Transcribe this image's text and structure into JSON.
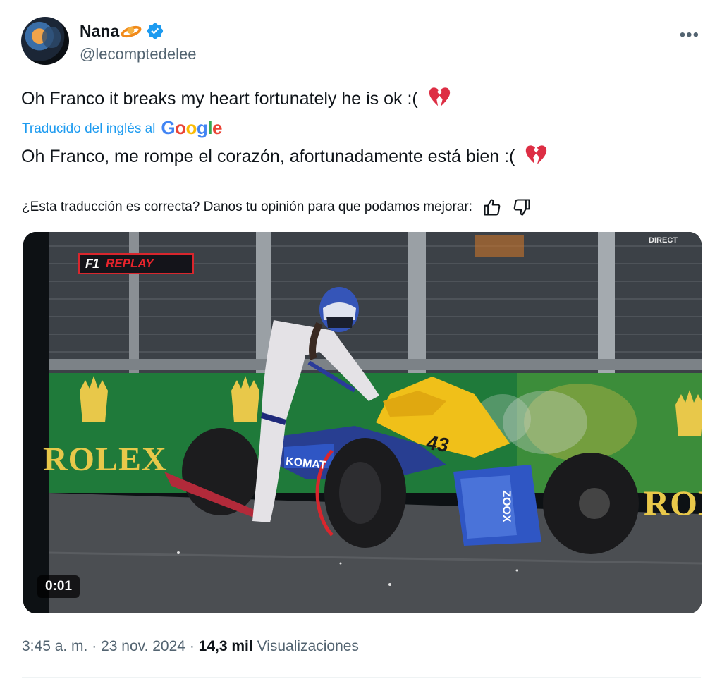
{
  "author": {
    "name": "Nana",
    "handle": "@lecomptedelee",
    "verified": true,
    "name_emoji": "orange-ring-emoji"
  },
  "tweet": {
    "original_text": "Oh Franco it breaks my heart fortunately he is ok :(",
    "translated_label": "Traducido del inglés al",
    "translator": "Google",
    "translated_text": "Oh Franco, me rompe el corazón, afortunadamente está bien :(",
    "emoji": "broken-heart-emoji"
  },
  "feedback": {
    "question": "¿Esta traducción es correcta? Danos tu opinión para que podamos mejorar:"
  },
  "media": {
    "duration": "0:01",
    "overlay_f1": "F1",
    "overlay_replay": "REPLAY",
    "overlay_direct": "DIRECT",
    "banner_brand": "ROLEX",
    "banner_brand_right": "ROL",
    "car_number": "43",
    "car_sponsor": "KOMAT",
    "car_sponsor_2": "ZOOX"
  },
  "meta": {
    "time": "3:45 a. m.",
    "separator": "·",
    "date": "23 nov. 2024",
    "views_count": "14,3 mil",
    "views_label": "Visualizaciones"
  },
  "colors": {
    "accent": "#1d9bf0",
    "secondary_text": "#536471",
    "primary_text": "#0f1419",
    "heart": "#e0245e"
  }
}
